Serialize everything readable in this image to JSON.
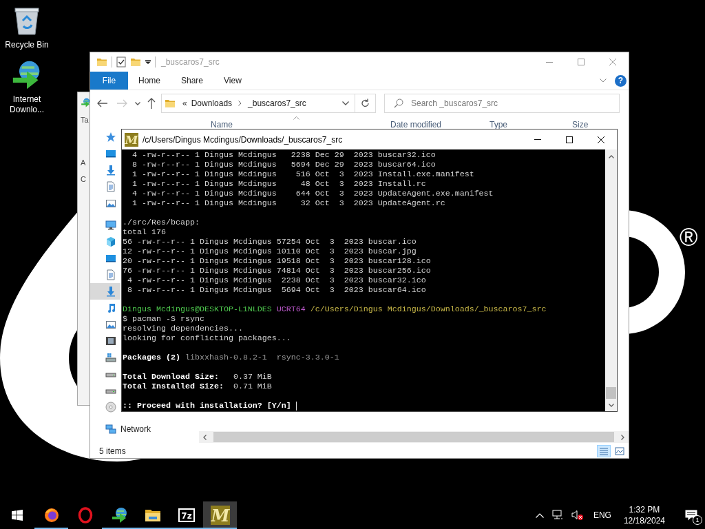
{
  "desktop": {
    "icons": [
      {
        "kind": "recyclebin",
        "label": "Recycle Bin"
      },
      {
        "kind": "downloader",
        "label": "Internet Downlo..."
      }
    ],
    "trademark": "®"
  },
  "background_window": {
    "texts": [
      "Ta",
      "A",
      "C"
    ]
  },
  "explorer": {
    "title": "_buscaros7_src",
    "ribbon_tabs": [
      {
        "label": "File",
        "selected": true
      },
      {
        "label": "Home",
        "selected": false
      },
      {
        "label": "Share",
        "selected": false
      },
      {
        "label": "View",
        "selected": false
      }
    ],
    "help": "?",
    "nav_buttons": [
      {
        "kind": "back",
        "disabled": false
      },
      {
        "kind": "forward",
        "disabled": true
      },
      {
        "kind": "recent",
        "disabled": false
      },
      {
        "kind": "up",
        "disabled": false
      }
    ],
    "path_overflow": "«",
    "path": [
      "Downloads",
      "_buscaros7_src"
    ],
    "search": {
      "placeholder": "Search _buscaros7_src"
    },
    "columns": [
      "Name",
      "Date modified",
      "Type",
      "Size"
    ],
    "nav_sections": [
      {
        "items": [
          {
            "kind": "quickaccess",
            "selected": false
          },
          {
            "kind": "desktop",
            "selected": false
          },
          {
            "kind": "downloads",
            "selected": false
          },
          {
            "kind": "documents",
            "selected": false
          },
          {
            "kind": "pictures",
            "selected": false
          }
        ]
      },
      {
        "items": [
          {
            "kind": "computer",
            "selected": false
          },
          {
            "kind": "objects",
            "selected": false
          },
          {
            "kind": "desktop",
            "selected": false
          },
          {
            "kind": "documents",
            "selected": false
          },
          {
            "kind": "downloads",
            "selected": true
          },
          {
            "kind": "music",
            "selected": false
          },
          {
            "kind": "pictures",
            "selected": false
          },
          {
            "kind": "videos",
            "selected": false
          },
          {
            "kind": "systemdrive",
            "selected": false
          },
          {
            "kind": "drive",
            "selected": false
          },
          {
            "kind": "drive",
            "selected": false
          },
          {
            "kind": "disc",
            "selected": false
          }
        ]
      },
      {
        "items": [
          {
            "kind": "network",
            "label": "Network",
            "selected": false
          }
        ]
      }
    ],
    "status": "5 items",
    "view_buttons": [
      {
        "kind": "details",
        "selected": true
      },
      {
        "kind": "largeicons",
        "selected": false
      }
    ]
  },
  "terminal": {
    "icon_letter": "M",
    "title": "/c/Users/Dingus Mcdingus/Downloads/_buscaros7_src",
    "lines": [
      {
        "kind": "text",
        "segments": [
          {
            "kind": "plain",
            "text": "  4 -rw-r--r-- 1 Dingus Mcdingus   2238 Dec 29  2023 buscar32.ico"
          }
        ]
      },
      {
        "kind": "text",
        "segments": [
          {
            "kind": "plain",
            "text": "  8 -rw-r--r-- 1 Dingus Mcdingus   5694 Dec 29  2023 buscar64.ico"
          }
        ]
      },
      {
        "kind": "text",
        "segments": [
          {
            "kind": "plain",
            "text": "  1 -rw-r--r-- 1 Dingus Mcdingus    516 Oct  3  2023 Install.exe.manifest"
          }
        ]
      },
      {
        "kind": "text",
        "segments": [
          {
            "kind": "plain",
            "text": "  1 -rw-r--r-- 1 Dingus Mcdingus     48 Oct  3  2023 Install.rc"
          }
        ]
      },
      {
        "kind": "text",
        "segments": [
          {
            "kind": "plain",
            "text": "  4 -rw-r--r-- 1 Dingus Mcdingus    644 Oct  3  2023 UpdateAgent.exe.manifest"
          }
        ]
      },
      {
        "kind": "text",
        "segments": [
          {
            "kind": "plain",
            "text": "  1 -rw-r--r-- 1 Dingus Mcdingus     32 Oct  3  2023 UpdateAgent.rc"
          }
        ]
      },
      {
        "kind": "blank"
      },
      {
        "kind": "text",
        "segments": [
          {
            "kind": "plain",
            "text": "./src/Res/bcapp:"
          }
        ]
      },
      {
        "kind": "text",
        "segments": [
          {
            "kind": "plain",
            "text": "total 176"
          }
        ]
      },
      {
        "kind": "text",
        "segments": [
          {
            "kind": "plain",
            "text": "56 -rw-r--r-- 1 Dingus Mcdingus 57254 Oct  3  2023 buscar.ico"
          }
        ]
      },
      {
        "kind": "text",
        "segments": [
          {
            "kind": "plain",
            "text": "12 -rw-r--r-- 1 Dingus Mcdingus 10110 Oct  3  2023 buscar.jpg"
          }
        ]
      },
      {
        "kind": "text",
        "segments": [
          {
            "kind": "plain",
            "text": "20 -rw-r--r-- 1 Dingus Mcdingus 19518 Oct  3  2023 buscar128.ico"
          }
        ]
      },
      {
        "kind": "text",
        "segments": [
          {
            "kind": "plain",
            "text": "76 -rw-r--r-- 1 Dingus Mcdingus 74814 Oct  3  2023 buscar256.ico"
          }
        ]
      },
      {
        "kind": "text",
        "segments": [
          {
            "kind": "plain",
            "text": " 4 -rw-r--r-- 1 Dingus Mcdingus  2238 Oct  3  2023 buscar32.ico"
          }
        ]
      },
      {
        "kind": "text",
        "segments": [
          {
            "kind": "plain",
            "text": " 8 -rw-r--r-- 1 Dingus Mcdingus  5694 Oct  3  2023 buscar64.ico"
          }
        ]
      },
      {
        "kind": "blank"
      },
      {
        "kind": "text",
        "segments": [
          {
            "kind": "user",
            "text": "Dingus Mcdingus@DESKTOP-L1NLDES"
          },
          {
            "kind": "env",
            "text": " UCRT64"
          },
          {
            "kind": "path",
            "text": " /c/Users/Dingus Mcdingus/Downloads/_buscaros7_src"
          }
        ]
      },
      {
        "kind": "text",
        "segments": [
          {
            "kind": "plain",
            "text": "$ pacman -S rsync"
          }
        ]
      },
      {
        "kind": "text",
        "segments": [
          {
            "kind": "plain",
            "text": "resolving dependencies..."
          }
        ]
      },
      {
        "kind": "text",
        "segments": [
          {
            "kind": "plain",
            "text": "looking for conflicting packages..."
          }
        ]
      },
      {
        "kind": "blank"
      },
      {
        "kind": "text",
        "segments": [
          {
            "kind": "bold",
            "text": "Packages (2)"
          },
          {
            "kind": "dim",
            "text": " libxxhash-0.8.2-1  rsync-3.3.0-1"
          }
        ]
      },
      {
        "kind": "blank"
      },
      {
        "kind": "text",
        "segments": [
          {
            "kind": "bold",
            "text": "Total Download Size:"
          },
          {
            "kind": "plain",
            "text": "   0.37 MiB"
          }
        ]
      },
      {
        "kind": "text",
        "segments": [
          {
            "kind": "bold",
            "text": "Total Installed Size:"
          },
          {
            "kind": "plain",
            "text": "  0.71 MiB"
          }
        ]
      },
      {
        "kind": "blank"
      },
      {
        "kind": "text",
        "cursor": true,
        "segments": [
          {
            "kind": "bold",
            "text": ":: Proceed with installation? [Y/n] "
          }
        ]
      }
    ]
  },
  "taskbar": {
    "apps": [
      {
        "kind": "firefox",
        "running": true,
        "active": false
      },
      {
        "kind": "opera",
        "running": false,
        "active": false
      },
      {
        "kind": "downloader",
        "running": true,
        "active": false
      },
      {
        "kind": "explorer",
        "running": true,
        "active": false
      },
      {
        "kind": "archiver",
        "label": "7z",
        "running": true,
        "active": false
      },
      {
        "kind": "msys",
        "label": "M",
        "running": true,
        "active": true
      }
    ],
    "tray": {
      "language": "ENG",
      "time": "1:32 PM",
      "date": "12/18/2024",
      "notification_count": "1"
    }
  }
}
